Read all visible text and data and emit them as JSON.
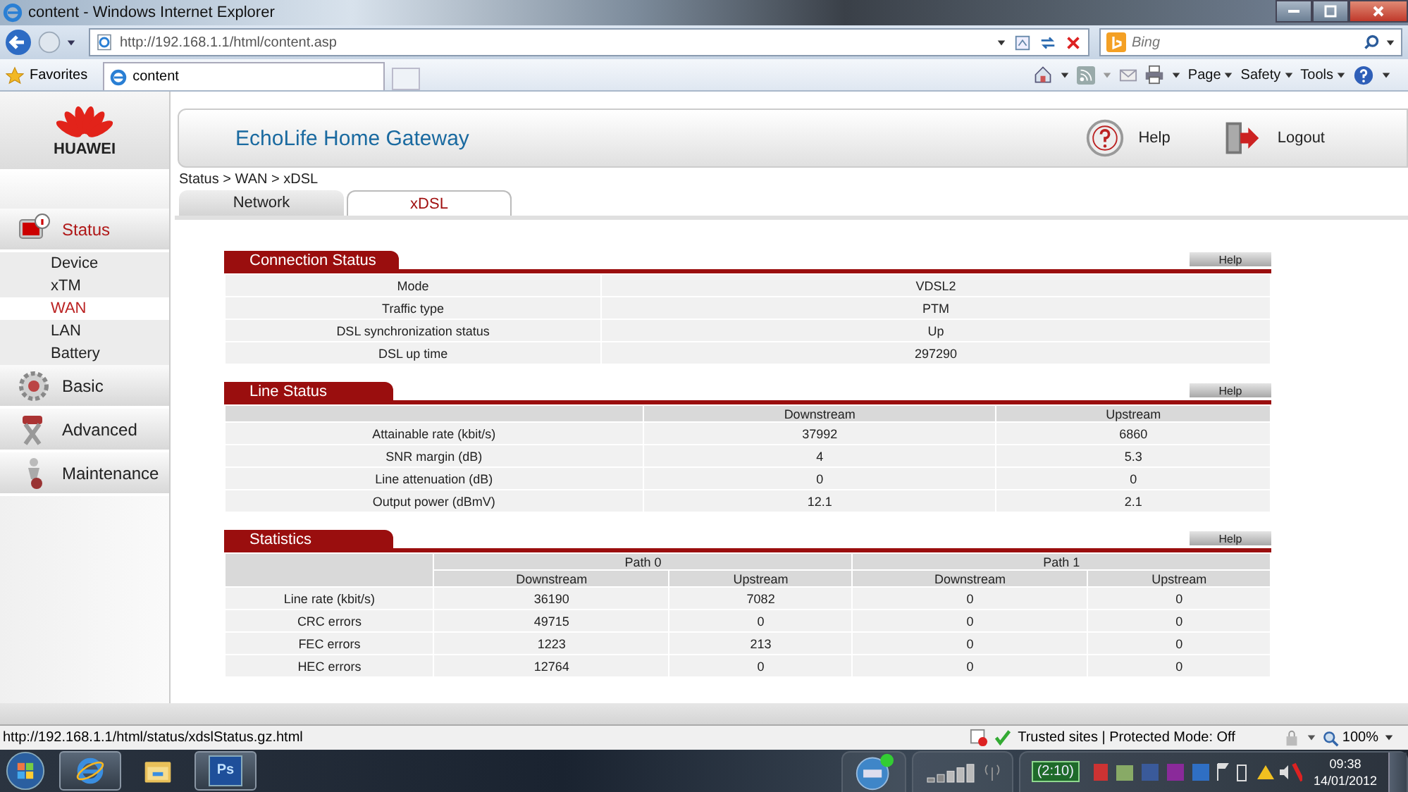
{
  "window": {
    "title": "content - Windows Internet Explorer"
  },
  "address_bar": {
    "url": "http://192.168.1.1/html/content.asp"
  },
  "search": {
    "placeholder": "Bing"
  },
  "favorites": {
    "label": "Favorites"
  },
  "browser_tab": {
    "label": "content"
  },
  "command_bar": [
    "Page",
    "Safety",
    "Tools"
  ],
  "logo": {
    "text": "HUAWEI"
  },
  "header": {
    "title": "EchoLife Home Gateway",
    "help": "Help",
    "logout": "Logout"
  },
  "breadcrumb": "Status > WAN > xDSL",
  "tabs": [
    {
      "label": "Network",
      "selected": false
    },
    {
      "label": "xDSL",
      "selected": true
    }
  ],
  "sidebar": [
    {
      "label": "Status",
      "expanded": true,
      "children": [
        {
          "label": "Device",
          "selected": false
        },
        {
          "label": "xTM",
          "selected": false
        },
        {
          "label": "WAN",
          "selected": true
        },
        {
          "label": "LAN",
          "selected": false
        },
        {
          "label": "Battery",
          "selected": false
        }
      ]
    },
    {
      "label": "Basic",
      "expanded": false
    },
    {
      "label": "Advanced",
      "expanded": false
    },
    {
      "label": "Maintenance",
      "expanded": false
    }
  ],
  "panels": [
    {
      "kind": "kv",
      "title": "Connection Status",
      "help": "Help",
      "rows": [
        {
          "label": "Mode",
          "value": "VDSL2"
        },
        {
          "label": "Traffic type",
          "value": "PTM"
        },
        {
          "label": "DSL synchronization status",
          "value": "Up"
        },
        {
          "label": "DSL up time",
          "value": "297290"
        }
      ]
    },
    {
      "kind": "table",
      "title": "Line Status",
      "help": "Help",
      "columns": [
        "Downstream",
        "Upstream"
      ],
      "rows": [
        {
          "label": "Attainable rate (kbit/s)",
          "values": [
            "37992",
            "6860"
          ]
        },
        {
          "label": "SNR margin (dB)",
          "values": [
            "4",
            "5.3"
          ]
        },
        {
          "label": "Line attenuation (dB)",
          "values": [
            "0",
            "0"
          ]
        },
        {
          "label": "Output power (dBmV)",
          "values": [
            "12.1",
            "2.1"
          ]
        }
      ]
    },
    {
      "kind": "grouped",
      "title": "Statistics",
      "help": "Help",
      "groups": [
        {
          "label": "Path 0",
          "columns": [
            "Downstream",
            "Upstream"
          ]
        },
        {
          "label": "Path 1",
          "columns": [
            "Downstream",
            "Upstream"
          ]
        }
      ],
      "rows": [
        {
          "label": "Line rate (kbit/s)",
          "values": [
            "36190",
            "7082",
            "0",
            "0"
          ]
        },
        {
          "label": "CRC errors",
          "values": [
            "49715",
            "0",
            "0",
            "0"
          ]
        },
        {
          "label": "FEC errors",
          "values": [
            "1223",
            "213",
            "0",
            "0"
          ]
        },
        {
          "label": "HEC errors",
          "values": [
            "12764",
            "0",
            "0",
            "0"
          ]
        }
      ]
    }
  ],
  "status_bar": {
    "url": "http://192.168.1.1/html/status/xdslStatus.gz.html",
    "zone": "Trusted sites | Protected Mode: Off",
    "zoom": "100%"
  },
  "taskbar": {
    "apps": [
      {
        "kind": "browser",
        "running": true
      },
      {
        "kind": "folder",
        "running": false
      },
      {
        "kind": "ps",
        "label": "Ps",
        "running": true
      }
    ],
    "battery": "(2:10)",
    "time": "09:38",
    "date": "14/01/2012"
  }
}
